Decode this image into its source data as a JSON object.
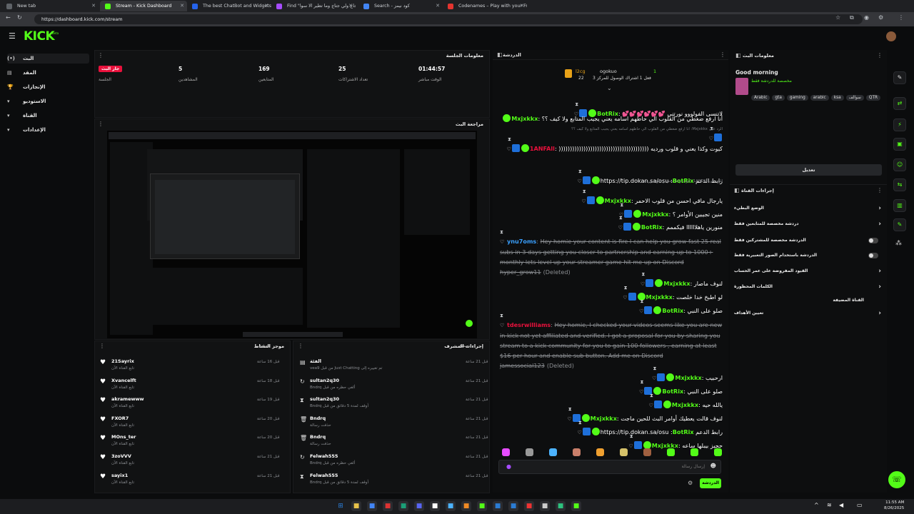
{
  "browser": {
    "tabs": [
      {
        "title": "New tab"
      },
      {
        "title": "Stream - Kick Dashboard"
      },
      {
        "title": "The best ChatBot and Widgets fo"
      },
      {
        "title": "Find \"نيو صدمان حاج ولي جتاج وما تطير الا سوا"
      },
      {
        "title": "Search - كود نيمز"
      },
      {
        "title": "Codenames – Play with your Frie"
      }
    ],
    "url": "https://dashboard.kick.com/stream"
  },
  "app": {
    "logo": "KICK",
    "logo_sup": "beta"
  },
  "sidebar": {
    "items": [
      {
        "label": "البث",
        "icon": "(•)"
      },
      {
        "label": "المقد",
        "icon": "▤"
      },
      {
        "label": "الإنجازات",
        "icon": "🏆"
      },
      {
        "label": "الاستوديو",
        "icon": "▾"
      },
      {
        "label": "القناة",
        "icon": "▾"
      },
      {
        "label": "الإعدادات",
        "icon": "▾"
      }
    ]
  },
  "session": {
    "title": "معلومات الجلسة",
    "stats": [
      {
        "value": "جار البث",
        "label": "الجلسة"
      },
      {
        "value": "5",
        "label": "المشاهدين"
      },
      {
        "value": "169",
        "label": "المتابعين"
      },
      {
        "value": "25",
        "label": "تعداد الاشتراكات"
      },
      {
        "value": "01:44:57",
        "label": "الوقت مباشر"
      }
    ]
  },
  "preview": {
    "title": "مراجعة البث"
  },
  "activity": {
    "title": "موجز النشاط",
    "filter": "تصفية",
    "items": [
      {
        "name": "21Sayrix",
        "sub": "تابع القناة الآن",
        "time": "قبل 16 ساعة"
      },
      {
        "name": "Xvancelft",
        "sub": "تابع القناة الآن",
        "time": "قبل 18 ساعة"
      },
      {
        "name": "akramewww",
        "sub": "تابع القناة الآن",
        "time": "قبل 19 ساعة"
      },
      {
        "name": "FXOR7",
        "sub": "تابع القناة الآن",
        "time": "قبل 20 ساعة"
      },
      {
        "name": "MOns_ter",
        "sub": "تابع القناة الآن",
        "time": "قبل 20 ساعة"
      },
      {
        "name": "3zoVVV",
        "sub": "تابع القناة الآن",
        "time": "قبل 21 ساعة"
      },
      {
        "name": "sayix1",
        "sub": "تابع القناة الآن",
        "time": "قبل 21 ساعة"
      }
    ]
  },
  "modactions": {
    "title": "إجراءات المشرف",
    "filter": "تصفية",
    "items": [
      {
        "name": "الفئة",
        "sub": "تم تغييره إلى Just Chatting من قبل vea9",
        "time": "قبل 21 ساعة",
        "icon": "▤"
      },
      {
        "name": "sultan2q30",
        "sub": "ألغي حظره من قبل Bndrq",
        "time": "قبل 21 ساعة",
        "icon": "↻"
      },
      {
        "name": "sultan2q30",
        "sub": "أوقف لمدة 5 دقائق من قبل Bndrq",
        "time": "قبل 21 ساعة",
        "icon": "⧗"
      },
      {
        "name": "Bndrq",
        "sub": "حذفت رسالة",
        "time": "قبل 21 ساعة",
        "icon": "🗑"
      },
      {
        "name": "Bndrq",
        "sub": "حذفت رسالة",
        "time": "قبل 21 ساعة",
        "icon": "🗑"
      },
      {
        "name": "Felwah555",
        "sub": "ألغي حظره من قبل Bndrq",
        "time": "قبل 21 ساعة",
        "icon": "↻"
      },
      {
        "name": "Felwah555",
        "sub": "أوقف لمدة 5 دقائق من قبل Bndrq",
        "time": "قبل 21 ساعة",
        "icon": "⧗"
      }
    ]
  },
  "chat": {
    "title": "الدردشة",
    "pinned": {
      "user": "ogokuo",
      "badge_user": "l2cg",
      "line": "فعل 1 اشتراك الوصول للمركز 3",
      "count1": "1",
      "count2": "22"
    },
    "messages": [
      {
        "user": "BotRix",
        "text": "لاتنسى الفولووو نورتني 💕💕💕💕💕💕",
        "color": "#53fc18"
      },
      {
        "user": "Mxjxkkx",
        "text": "أنا ارفع ضغطي من القلوب الي حاطهم اسامه يعني يجيب المتابع ولا كيف ؟؟",
        "color": "#53fc18"
      },
      {
        "user": "1ANFAll",
        "text": "كيوت وكذا يعني و قلوب ورديه ((((((((((((((((((((((((((((((((((((((((",
        "color": "#e9113c",
        "reply": "الرد على Mxjxkkx: أنا ارفع ضغطي من القلوب الي حاطهم اسامه يعني يجيب المتابع ولا كيف ؟؟"
      },
      {
        "user": "BotRix",
        "text": "رابط الدعم https://tip.dokan.sa/osu",
        "color": "#53fc18"
      },
      {
        "user": "Mxjxkkx",
        "text": "يارجال ماقي احسن من قلوب الاحمر",
        "color": "#53fc18",
        "reply": "الرد على 1ANFAll: كيوت وكذا يعني و قلوب ورديه"
      },
      {
        "user": "Mxjxkkx",
        "text": "منين تجيبين الأوامر ؟",
        "color": "#53fc18"
      },
      {
        "user": "BotRix",
        "text": "منورين ياهلاااااا فيكممم",
        "color": "#53fc18"
      },
      {
        "user": "ynu7oms",
        "text": "Hey homie your content is fire I can help you grow fast 25 real subs in 3 days getting you closer to partnership and earning up to 1000+ monthly lets level up your streamer game hit me up on Discord hyper_grow11",
        "color": "#3aa0ff",
        "deleted": true
      },
      {
        "user": "Mxjxkkx",
        "text": "لنوف ماصار",
        "color": "#53fc18"
      },
      {
        "user": "Mxjxkkx",
        "text": "لو اطبخ خدا خلصت",
        "color": "#53fc18"
      },
      {
        "user": "BotRix",
        "text": "صلو على النبي",
        "color": "#53fc18"
      },
      {
        "user": "tdesrwilliams",
        "text": "Hey homie, I checked your videos seems like you are new in kick not yet affiliated and verified. I got a proposal for you by sharing you stream to a kick community for you to gain 100 followers , earning at least $16 per hour and enable sub button. Add me on Discord jamessocial123",
        "color": "#e9113c",
        "deleted": true
      },
      {
        "user": "Mxjxkkx",
        "text": "ارحبيب",
        "color": "#53fc18"
      },
      {
        "user": "BotRix",
        "text": "صلو على النبي",
        "color": "#53fc18"
      },
      {
        "user": "Mxjxkkx",
        "text": "يالله حيه",
        "color": "#53fc18"
      },
      {
        "user": "Mxjxkkx",
        "text": "لنوف قالت يعطيك أوامر البث للحين ماجت",
        "color": "#53fc18"
      },
      {
        "user": "BotRix",
        "text": "رابط الدعم https://tip.dokan.sa/osu",
        "color": "#53fc18"
      },
      {
        "user": "Mxjxkkx",
        "text": "حجيز بيبلها ساعه",
        "color": "#53fc18"
      }
    ],
    "deleted_label": "(Deleted)",
    "input_placeholder": "إرسال رسالة",
    "send_label": "الدردشة"
  },
  "streaminfo": {
    "title": "معلومات البث",
    "stream_title": "Good morning",
    "category_line": "مخصصة للدردشة فقط",
    "tags": [
      "Arabic",
      "gta",
      "gaming",
      "arabic",
      "ksa",
      "سوالف",
      "QTR"
    ],
    "edit_label": "تعديل"
  },
  "channelactions": {
    "title": "إجراءات القناة",
    "options": [
      {
        "label": "الوضع البطيء",
        "kind": "arrow"
      },
      {
        "label": "دردشة مخصصة للمتابعين فقط",
        "kind": "arrow"
      },
      {
        "label": "الدردشة مخصصة للمشتركين فقط",
        "kind": "toggle"
      },
      {
        "label": "الدردشة باستخدام الصور التعبيرية فقط",
        "kind": "toggle"
      },
      {
        "label": "القيود المفروضة على عمر الحساب",
        "kind": "arrow"
      },
      {
        "label": "الكلمات المحظورة",
        "kind": "arrow"
      },
      {
        "label": "القناة المضيفة",
        "kind": "none"
      },
      {
        "label": "تعيين الأهداف",
        "kind": "arrow"
      }
    ]
  },
  "taskbar": {
    "time": "11:55 AM",
    "date": "8/26/2025"
  }
}
